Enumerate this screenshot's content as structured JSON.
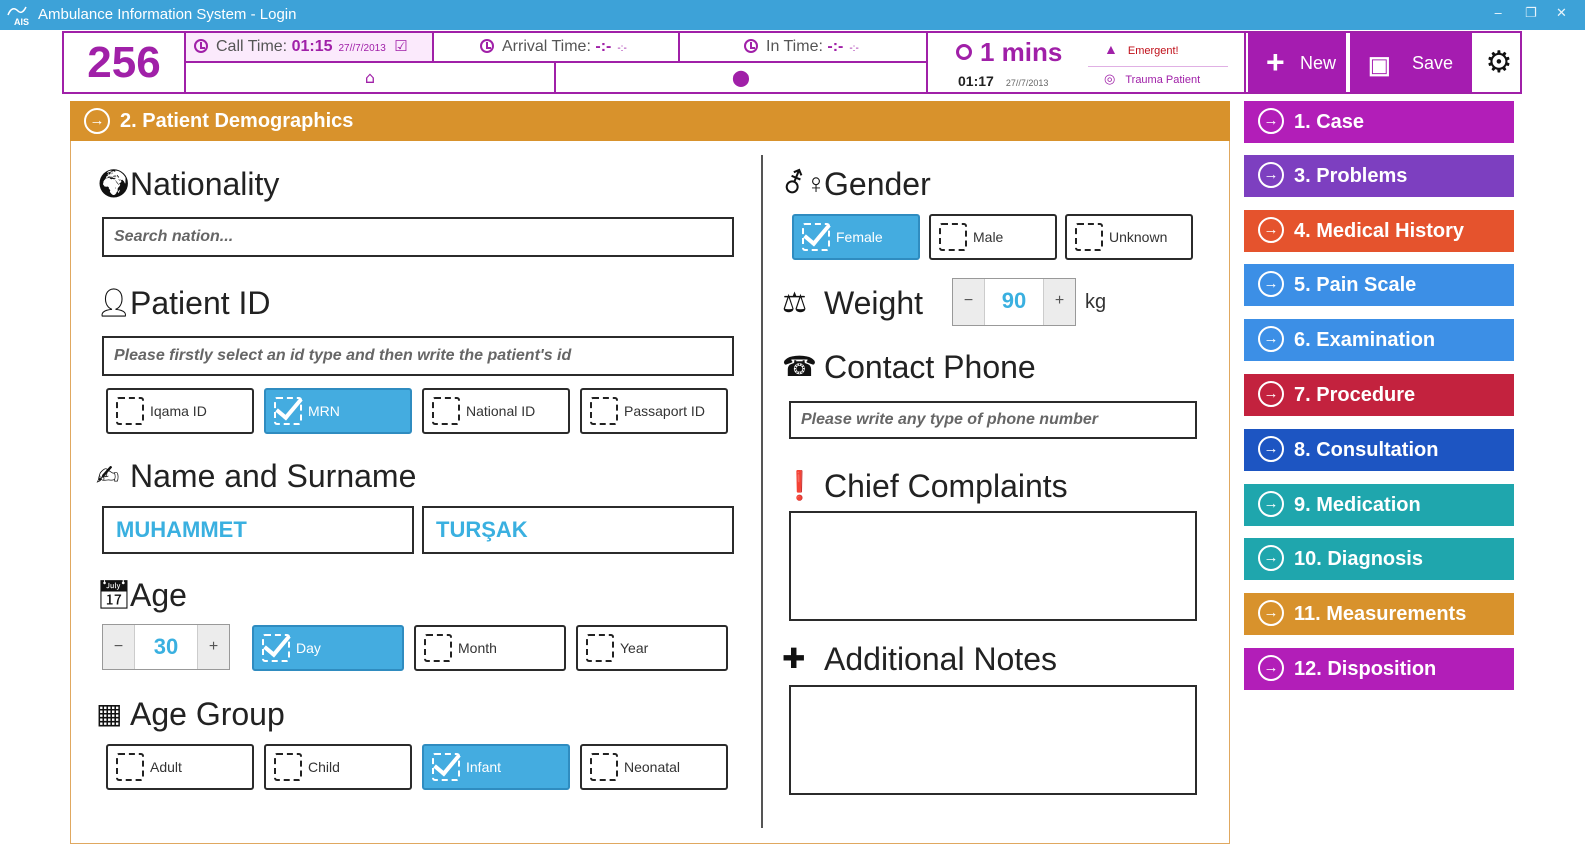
{
  "window": {
    "title": "Ambulance Information System - Login",
    "logo_text": "AIS"
  },
  "topbar": {
    "case_number": "256",
    "call_time": {
      "label": "Call Time:",
      "value": "01:15",
      "date": "27//7/2013"
    },
    "arrival_time": {
      "label": "Arrival Time:",
      "value": "-:-",
      "date": "-:-"
    },
    "in_time": {
      "label": "In Time:",
      "value": "-:-",
      "date": "-:-"
    },
    "elapsed": {
      "value": "1 mins",
      "now": "01:17",
      "now_date": "27//7/2013"
    },
    "flags": {
      "emergent": "Emergent!",
      "trauma": "Trauma Patient"
    },
    "buttons": {
      "new": "New",
      "save": "Save"
    }
  },
  "section": {
    "title": "2. Patient Demographics"
  },
  "nationality": {
    "label": "Nationality",
    "placeholder": "Search nation..."
  },
  "patient_id": {
    "label": "Patient ID",
    "placeholder": "Please firstly select an id type and then write the patient's id",
    "types": [
      {
        "label": "Iqama ID",
        "checked": false
      },
      {
        "label": "MRN",
        "checked": true
      },
      {
        "label": "National ID",
        "checked": false
      },
      {
        "label": "Passaport ID",
        "checked": false
      }
    ]
  },
  "name": {
    "label": "Name and Surname",
    "first": "MUHAMMET",
    "last": "TURŞAK"
  },
  "age": {
    "label": "Age",
    "value": "30",
    "minus": "−",
    "plus": "+",
    "units": [
      {
        "label": "Day",
        "checked": true
      },
      {
        "label": "Month",
        "checked": false
      },
      {
        "label": "Year",
        "checked": false
      }
    ]
  },
  "age_group": {
    "label": "Age Group",
    "options": [
      {
        "label": "Adult",
        "checked": false
      },
      {
        "label": "Child",
        "checked": false
      },
      {
        "label": "Infant",
        "checked": true
      },
      {
        "label": "Neonatal",
        "checked": false
      }
    ]
  },
  "gender": {
    "label": "Gender",
    "options": [
      {
        "label": "Female",
        "checked": true
      },
      {
        "label": "Male",
        "checked": false
      },
      {
        "label": "Unknown",
        "checked": false
      }
    ]
  },
  "weight": {
    "label": "Weight",
    "value": "90",
    "unit": "kg",
    "minus": "−",
    "plus": "+"
  },
  "phone": {
    "label": "Contact Phone",
    "placeholder": "Please write any type of phone number"
  },
  "complaints": {
    "label": "Chief Complaints"
  },
  "notes": {
    "label": "Additional Notes"
  },
  "nav": [
    {
      "label": "1. Case",
      "color": "#b21eb8"
    },
    {
      "label": "3. Problems",
      "color": "#7d3fc0"
    },
    {
      "label": "4. Medical History",
      "color": "#e5532d"
    },
    {
      "label": "5. Pain Scale",
      "color": "#3c8fe6"
    },
    {
      "label": "6. Examination",
      "color": "#3c8fe6"
    },
    {
      "label": "7. Procedure",
      "color": "#c3223e"
    },
    {
      "label": "8. Consultation",
      "color": "#1d55c2"
    },
    {
      "label": "9. Medication",
      "color": "#1fa6ad"
    },
    {
      "label": "10. Diagnosis",
      "color": "#1fa6ad"
    },
    {
      "label": "11. Measurements",
      "color": "#d8922c"
    },
    {
      "label": "12. Disposition",
      "color": "#b21eb8"
    }
  ]
}
